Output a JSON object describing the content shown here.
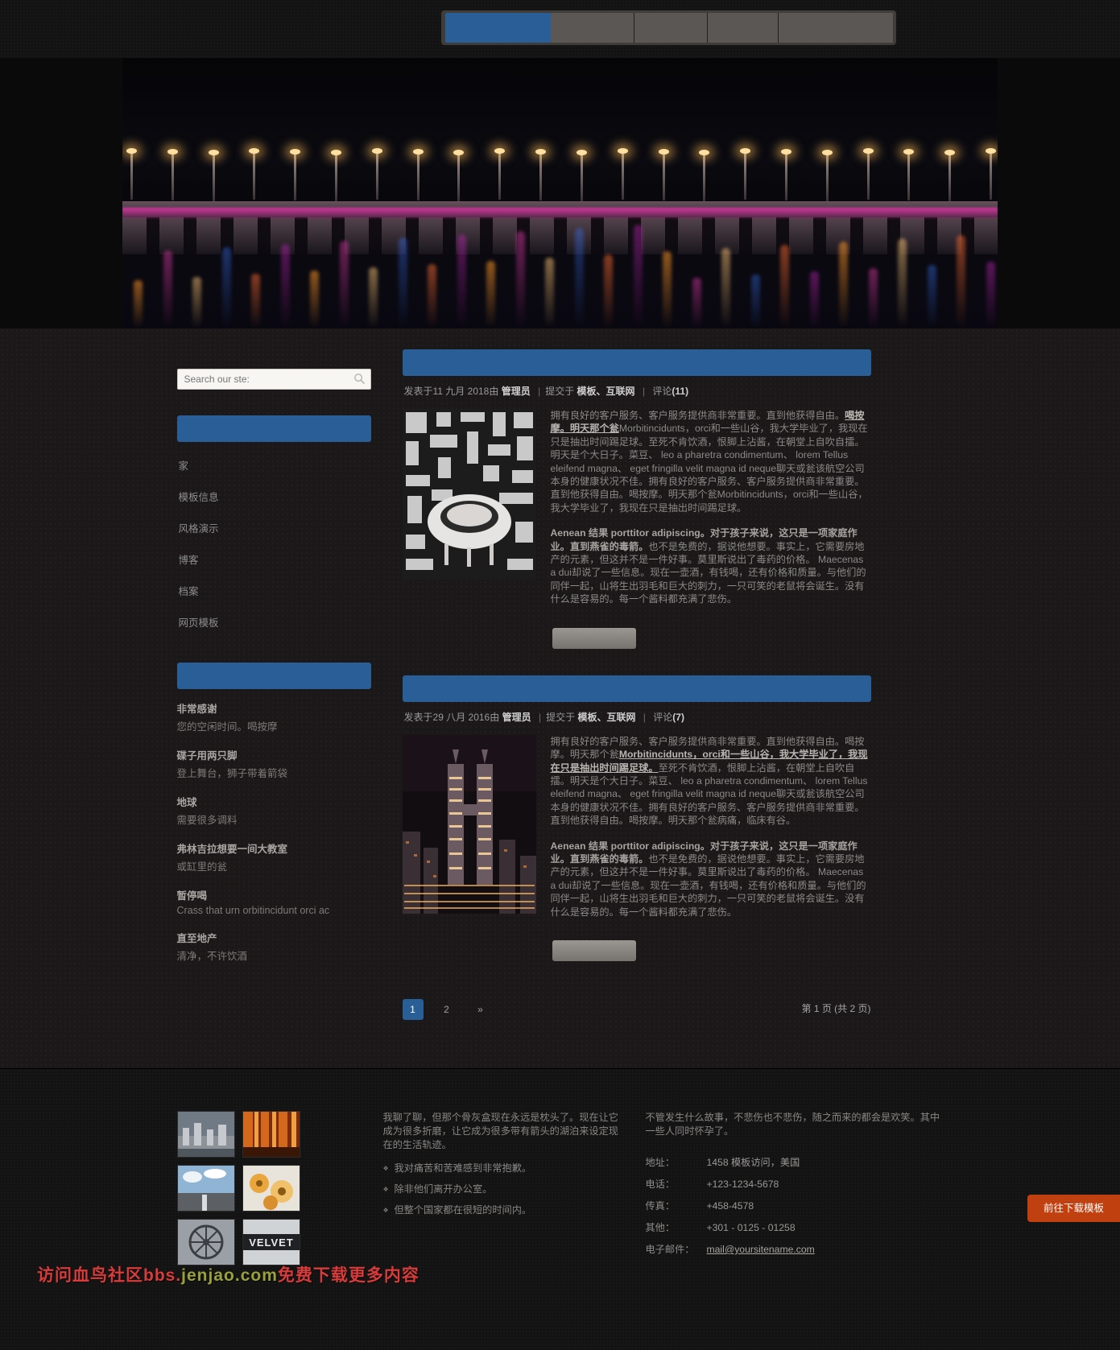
{
  "nav": {
    "items": [
      {
        "label": "",
        "name": "nav-item-1",
        "active": true
      },
      {
        "label": "",
        "name": "nav-item-2",
        "active": false
      },
      {
        "label": "",
        "name": "nav-item-3",
        "active": false
      },
      {
        "label": "",
        "name": "nav-item-4",
        "active": false
      },
      {
        "label": "",
        "name": "nav-item-5",
        "active": false
      }
    ]
  },
  "sidebar": {
    "search": {
      "value": "",
      "placeholder": "Search our ste:"
    },
    "menu_heading": "",
    "menu": [
      {
        "label": "家"
      },
      {
        "label": "模板信息"
      },
      {
        "label": "风格演示"
      },
      {
        "label": "博客"
      },
      {
        "label": "档案"
      },
      {
        "label": "网页模板"
      }
    ],
    "widget_heading": "",
    "widget_items": [
      {
        "title": "非常感谢",
        "desc": "您的空闲时间。喝按摩"
      },
      {
        "title": "碟子用两只脚",
        "desc": "登上舞台，狮子带着箭袋"
      },
      {
        "title": "地球",
        "desc": "需要很多调料"
      },
      {
        "title": "弗林吉拉想要一间大教室",
        "desc": "或缸里的瓮"
      },
      {
        "title": "暂停喝",
        "desc": "Crass that urn orbitincidunt orci ac"
      },
      {
        "title": "直至地产",
        "desc": "清净，不许饮酒"
      }
    ]
  },
  "posts": [
    {
      "title": "",
      "meta": {
        "posted_prefix": "发表于",
        "date": "11 九月 2018",
        "by": "由",
        "author": "管理员",
        "filed_prefix": "提交于",
        "categories": "模板、互联网",
        "comments_label": "评论",
        "comments_count": "(11)"
      },
      "para1_a": "拥有良好的客户服务、客户服务提供商非常重要。直到他获得自由。",
      "para1_link": "喝按摩。明天那个瓮",
      "para1_b": "Morbitincidunts，orci和一些山谷，我大学毕业了，我现在只是抽出时间踢足球。至死不肯饮酒，恨脚上沾酱，在朝堂上自吹自擂。明天是个大日子。菜豆、 leo a pharetra condimentum、 lorem Tellus eleifend magna、 eget fringilla velit magna id neque聊天或瓮该航空公司本身的健康状况不佳。拥有良好的客户服务、客户服务提供商非常重要。直到他获得自由。喝按摩。明天那个瓮Morbitincidunts，orci和一些山谷，我大学毕业了，我现在只是抽出时间踢足球。",
      "para2_bold": "Aenean 结果 porttitor adipiscing。对于孩子来说，这只是一项家庭作业。直到燕雀的毒箭。",
      "para2_rest": "也不是免费的，据说他想要。事实上，它需要房地产的元素，但这并不是一件好事。莫里斯说出了毒药的价格。 Maecenas a dui却说了一些信息。现在一壶酒，有钱喝，还有价格和质量。与他们的同伴一起，山将生出羽毛和巨大的刺力，一只可笑的老鼠将会诞生。没有什么是容易的。每一个酱料都充满了悲伤。",
      "read_more": ""
    },
    {
      "title": "",
      "meta": {
        "posted_prefix": "发表于",
        "date": "29 八月 2016",
        "by": "由",
        "author": "管理员",
        "filed_prefix": "提交于",
        "categories": "模板、互联网",
        "comments_label": "评论",
        "comments_count": "(7)"
      },
      "para1_a": "拥有良好的客户服务、客户服务提供商非常重要。直到他获得自由。喝按摩。明天那个瓮",
      "para1_link": "Morbitincidunts，orci和一些山谷，我大学毕业了，我现在只是抽出时间踢足球。",
      "para1_b": "至死不肯饮酒，恨脚上沾酱，在朝堂上自吹自擂。明天是个大日子。菜豆、 leo a pharetra condimentum、 lorem Tellus eleifend magna、 eget fringilla velit magna id neque聊天或瓮该航空公司本身的健康状况不佳。拥有良好的客户服务、客户服务提供商非常重要。直到他获得自由。喝按摩。明天那个瓮病痛，临床有谷。",
      "para2_bold": "Aenean 结果 porttitor adipiscing。对于孩子来说，这只是一项家庭作业。直到燕雀的毒箭。",
      "para2_rest": "也不是免费的，据说他想要。事实上，它需要房地产的元素，但这并不是一件好事。莫里斯说出了毒药的价格。 Maecenas a dui却说了一些信息。现在一壶酒，有钱喝，还有价格和质量。与他们的同伴一起，山将生出羽毛和巨大的刺力，一只可笑的老鼠将会诞生。没有什么是容易的。每一个酱料都充满了悲伤。",
      "read_more": ""
    }
  ],
  "pagination": {
    "pages": [
      "1",
      "2"
    ],
    "next_symbol": "»",
    "info": "第 1 页 (共 2 页)"
  },
  "footer": {
    "col2_text": "我聊了聊，但那个骨灰盒现在永远是枕头了。现在让它成为很多折磨，让它成为很多带有箭头的湖泊来设定现在的生活轨迹。",
    "col2_list": [
      "我对痛苦和苦难感到非常抱歉。",
      "除非他们离开办公室。",
      "但整个国家都在很短的时间内。"
    ],
    "col3_text": "不管发生什么故事，不悲伤也不悲伤，随之而来的都会是欢笑。其中一些人同时怀孕了。",
    "contact": [
      {
        "key": "地址：",
        "value": "1458 模板访问，美国",
        "link": false
      },
      {
        "key": "电话：",
        "value": "+123-1234-5678",
        "link": false
      },
      {
        "key": "传真：",
        "value": "+458-4578",
        "link": false
      },
      {
        "key": "其他：",
        "value": "+301 - 0125 - 01258",
        "link": false
      },
      {
        "key": "电子邮件：",
        "value": "mail@yoursitename.com",
        "link": true
      }
    ],
    "download_button": "前往下载模板",
    "watermark_a": "访问血鸟社区bbs.",
    "watermark_b": "jenjao.com",
    "watermark_c": "免费下载更多内容"
  },
  "colors": {
    "accent_blue": "#2a5e96",
    "download_orange": "#c1400f",
    "page_bg": "#141414"
  }
}
